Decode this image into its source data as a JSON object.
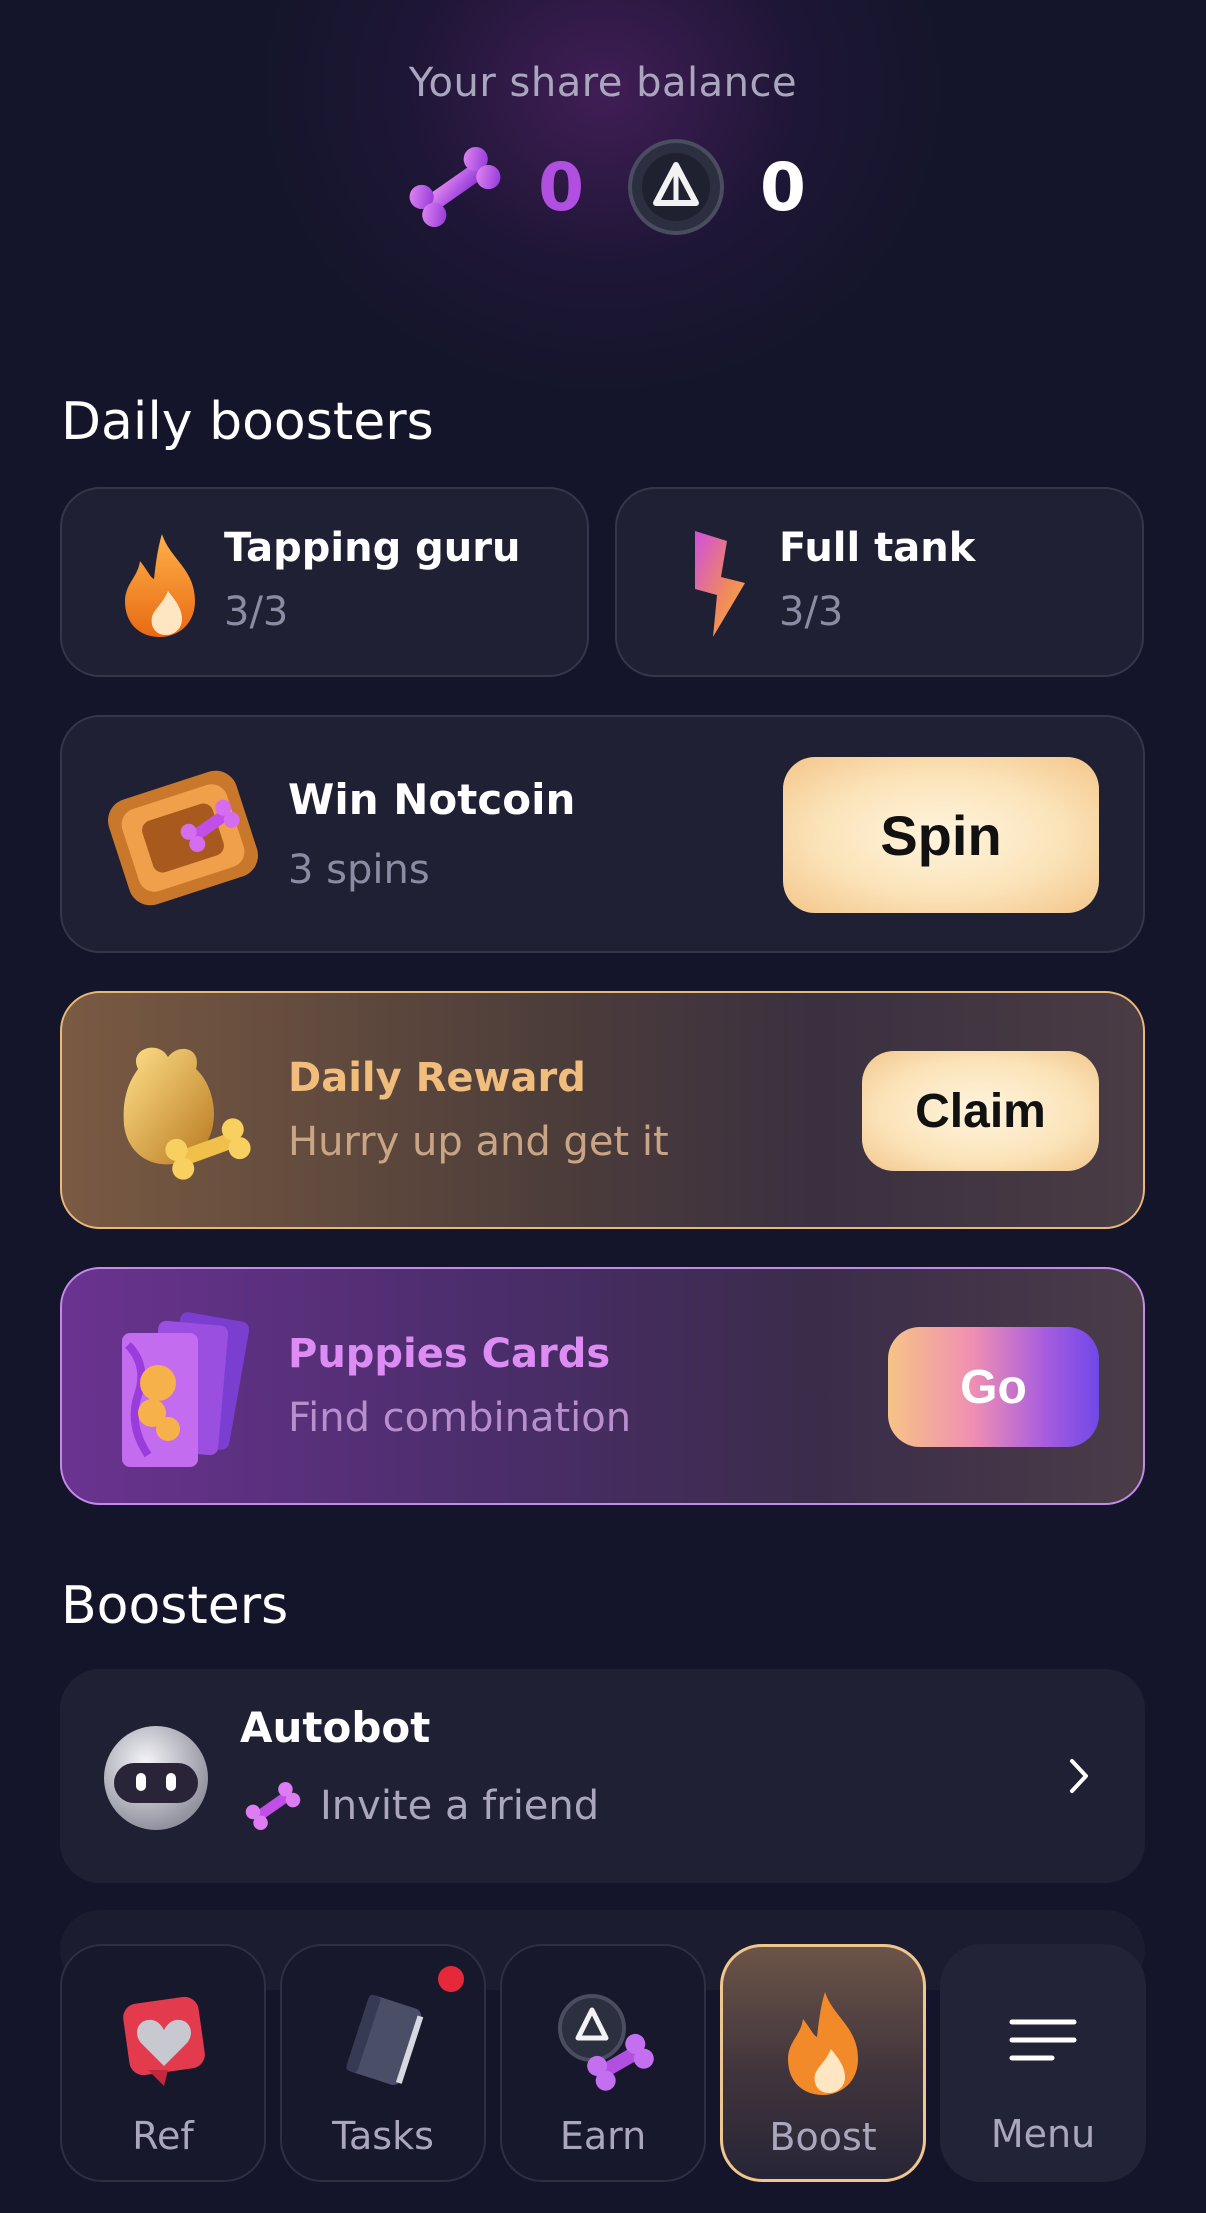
{
  "balance": {
    "title": "Your share balance",
    "bones_value": "0",
    "coin_value": "0"
  },
  "daily_boosters": {
    "title": "Daily boosters",
    "tapping_guru": {
      "title": "Tapping guru",
      "count": "3/3",
      "icon": "flame-icon"
    },
    "full_tank": {
      "title": "Full tank",
      "count": "3/3",
      "icon": "lightning-icon"
    }
  },
  "win_notcoin": {
    "title": "Win Notcoin",
    "subtitle": "3 spins",
    "button": "Spin"
  },
  "daily_reward": {
    "title": "Daily Reward",
    "subtitle": "Hurry up and get it",
    "button": "Claim"
  },
  "puppies_cards": {
    "title": "Puppies Cards",
    "subtitle": "Find combination",
    "button": "Go"
  },
  "boosters": {
    "title": "Boosters",
    "autobot": {
      "title": "Autobot",
      "subtitle": "Invite a friend"
    }
  },
  "nav": {
    "items": [
      {
        "label": "Ref",
        "icon": "heart-badge-icon"
      },
      {
        "label": "Tasks",
        "icon": "book-icon",
        "notification": true
      },
      {
        "label": "Earn",
        "icon": "coin-bone-icon"
      },
      {
        "label": "Boost",
        "icon": "flame-icon",
        "active": true
      },
      {
        "label": "Menu",
        "icon": "hamburger-icon"
      }
    ]
  },
  "colors": {
    "background": "#14152a",
    "accent_purple": "#b04fe0",
    "accent_gold": "#f1bd7d",
    "card": "#1f2033"
  }
}
